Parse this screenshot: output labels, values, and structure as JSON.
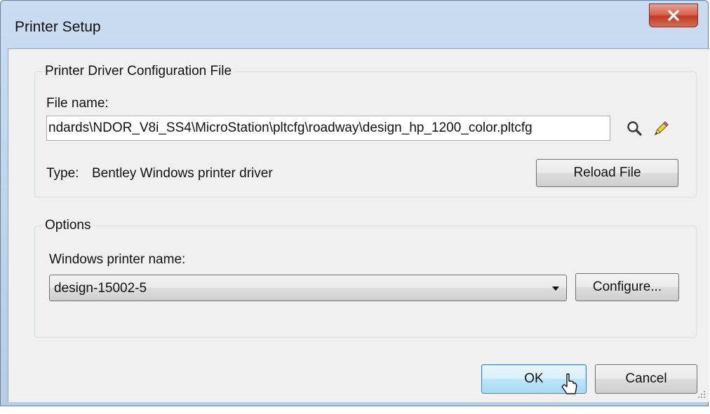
{
  "window": {
    "title": "Printer Setup",
    "close_glyph": "x"
  },
  "driver_group": {
    "legend": "Printer Driver Configuration File",
    "file_name_label": "File name:",
    "file_name_value": "ndards\\NDOR_V8i_SS4\\MicroStation\\pltcfg\\roadway\\design_hp_1200_color.pltcfg",
    "browse_icon": "magnifier-icon",
    "edit_icon": "pencil-icon",
    "type_label": "Type:",
    "type_value": "Bentley Windows printer driver",
    "reload_label": "Reload File"
  },
  "options_group": {
    "legend": "Options",
    "printer_name_label": "Windows printer name:",
    "printer_selected": "design-15002-5",
    "configure_label": "Configure..."
  },
  "footer": {
    "ok_label": "OK",
    "cancel_label": "Cancel"
  },
  "colors": {
    "client_bg": "#f0f0f0",
    "frame": "#c9dcf1",
    "close_red": "#c33a22",
    "default_button": "#bee6fd"
  }
}
